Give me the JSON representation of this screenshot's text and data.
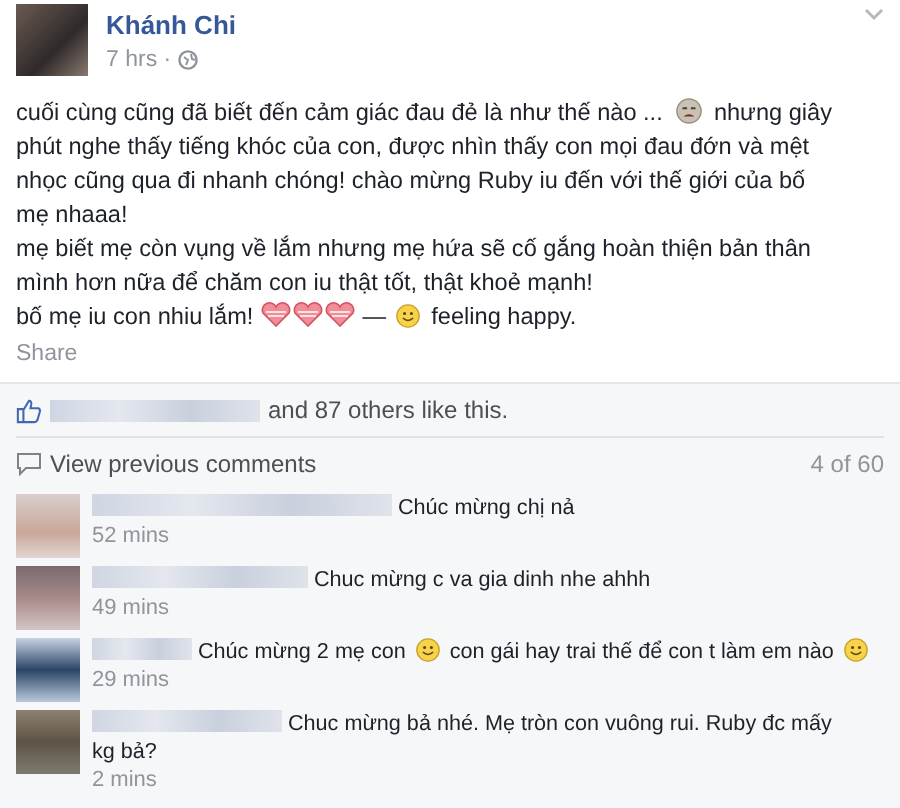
{
  "post": {
    "author": "Khánh Chi",
    "time": "7 hrs ·",
    "lines": [
      [
        {
          "kind": "text",
          "text": "cuối cùng cũng đã biết đến cảm giác đau đẻ là như thế nào ..."
        },
        {
          "kind": "crying"
        },
        {
          "kind": "text",
          "text": "nhưng giây"
        }
      ],
      [
        {
          "kind": "text",
          "text": "phút nghe thấy tiếng khóc của con, được nhìn thấy con mọi đau đớn và mệt"
        }
      ],
      [
        {
          "kind": "text",
          "text": "nhọc cũng qua đi nhanh chóng! chào mừng Ruby iu đến với thế giới của bố"
        }
      ],
      [
        {
          "kind": "text",
          "text": "mẹ nhaaa!"
        }
      ],
      [
        {
          "kind": "text",
          "text": "mẹ biết mẹ còn vụng về lắm nhưng mẹ hứa sẽ cố gắng hoàn thiện bản thân"
        }
      ],
      [
        {
          "kind": "text",
          "text": "mình hơn nữa để chăm con iu thật tốt, thật khoẻ mạnh!"
        }
      ],
      [
        {
          "kind": "text",
          "text": "bố mẹ iu con nhiu lắm!"
        },
        {
          "kind": "heart"
        },
        {
          "kind": "heart"
        },
        {
          "kind": "heart"
        },
        {
          "kind": "text",
          "text": "—"
        },
        {
          "kind": "smile"
        },
        {
          "kind": "text",
          "text": "feeling happy."
        }
      ]
    ],
    "share": "Share"
  },
  "likes": {
    "text": "and 87 others like this."
  },
  "comments_header": {
    "link": "View previous comments",
    "count": "4 of 60"
  },
  "comments": [
    {
      "lines": [
        [
          {
            "kind": "text",
            "text": "Chúc mừng chị nả"
          }
        ]
      ],
      "time": "52 mins"
    },
    {
      "lines": [
        [
          {
            "kind": "text",
            "text": "Chuc mừng c va gia dinh nhe ahhh"
          }
        ]
      ],
      "time": "49 mins"
    },
    {
      "lines": [
        [
          {
            "kind": "text",
            "text": "Chúc mừng 2 mẹ con"
          },
          {
            "kind": "smile"
          },
          {
            "kind": "text",
            "text": "con gái hay trai thế để con t làm em nào"
          },
          {
            "kind": "smile"
          }
        ]
      ],
      "time": "29 mins"
    },
    {
      "lines": [
        [
          {
            "kind": "text",
            "text": "Chuc mừng bả nhé. Mẹ tròn con vuông rui. Ruby đc mấy"
          }
        ],
        [
          {
            "kind": "text",
            "text": "kg bả?"
          }
        ]
      ],
      "time": "2 mins"
    }
  ]
}
